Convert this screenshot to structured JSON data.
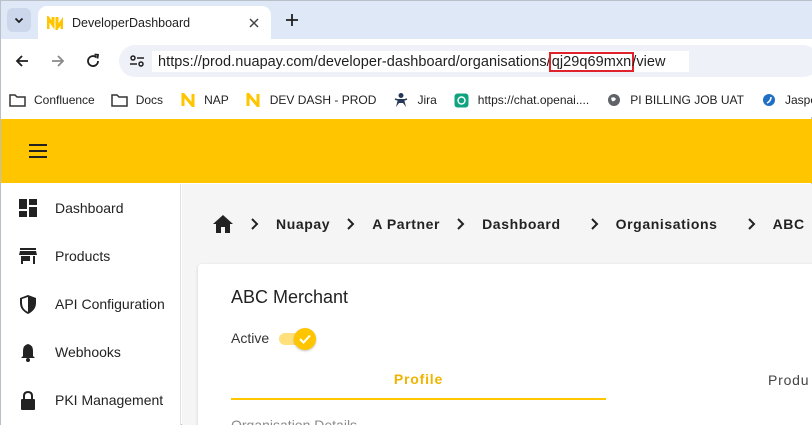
{
  "browser": {
    "tab_title": "DeveloperDashboard",
    "url_before": "https://prod.nuapay.com/developer-dashboard/organisations/",
    "url_highlight": "qj29q69mxn",
    "url_after": "/view",
    "highlight_color": "#e0222a",
    "bookmarks": [
      {
        "label": "Confluence",
        "icon": "folder-icon"
      },
      {
        "label": "Docs",
        "icon": "folder-icon"
      },
      {
        "label": "NAP",
        "icon": "nuapay-logo-icon"
      },
      {
        "label": "DEV DASH - PROD",
        "icon": "nuapay-logo-icon"
      },
      {
        "label": "Jira",
        "icon": "jira-icon"
      },
      {
        "label": "https://chat.openai....",
        "icon": "openai-icon"
      },
      {
        "label": "PI BILLING JOB UAT",
        "icon": "globe-icon"
      },
      {
        "label": "Jasper",
        "icon": "jasper-icon"
      }
    ]
  },
  "app": {
    "brand_color": "#ffc600",
    "sidebar": [
      {
        "label": "Dashboard",
        "icon": "dashboard-icon"
      },
      {
        "label": "Products",
        "icon": "store-icon"
      },
      {
        "label": "API Configuration",
        "icon": "shield-icon"
      },
      {
        "label": "Webhooks",
        "icon": "bell-icon"
      },
      {
        "label": "PKI Management",
        "icon": "lock-icon"
      }
    ],
    "breadcrumbs": [
      "Nuapay",
      "A Partner",
      "Dashboard",
      "Organisations",
      "ABC"
    ],
    "card": {
      "title": "ABC Merchant",
      "status_label": "Active",
      "status_on": true,
      "tabs": [
        "Profile",
        "Produ"
      ],
      "section_title": "Organisation Details"
    }
  }
}
